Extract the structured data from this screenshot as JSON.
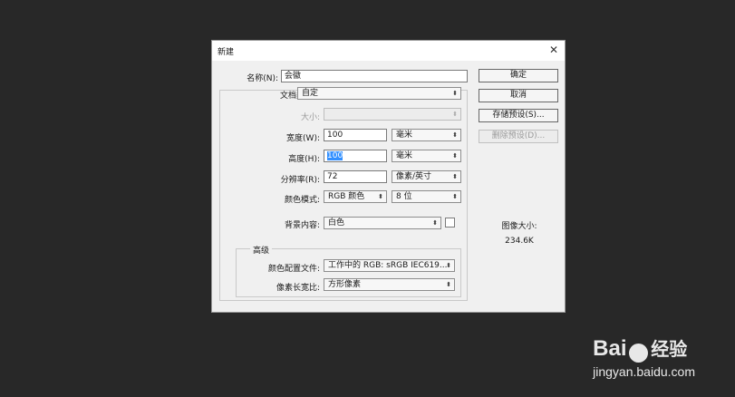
{
  "dialog": {
    "title": "新建",
    "close_glyph": "✕",
    "name_label": "名称(N):",
    "name_value": "会徽",
    "preset_label": "文档类型:",
    "preset_value": "自定",
    "size_label": "大小:",
    "size_value": "",
    "width_label": "宽度(W):",
    "width_value": "100",
    "width_unit": "毫米",
    "height_label": "高度(H):",
    "height_value": "100",
    "height_unit": "毫米",
    "resolution_label": "分辨率(R):",
    "resolution_value": "72",
    "resolution_unit": "像素/英寸",
    "color_mode_label": "颜色模式:",
    "color_mode_value": "RGB 颜色",
    "bit_depth_value": "8 位",
    "background_label": "背景内容:",
    "background_value": "白色",
    "advanced_label": "高级",
    "color_profile_label": "颜色配置文件:",
    "color_profile_value": "工作中的 RGB: sRGB IEC619...",
    "pixel_aspect_label": "像素长宽比:",
    "pixel_aspect_value": "方形像素"
  },
  "buttons": {
    "ok": "确定",
    "cancel": "取消",
    "save_preset": "存储预设(S)...",
    "delete_preset": "删除预设(D)..."
  },
  "info": {
    "image_size_label": "图像大小:",
    "image_size_value": "234.6K"
  },
  "icons": {
    "dropdown_arrow": "⬍"
  },
  "watermark": {
    "logo_text_1": "Bai",
    "logo_text_2": "经验",
    "url": "jingyan.baidu.com"
  }
}
